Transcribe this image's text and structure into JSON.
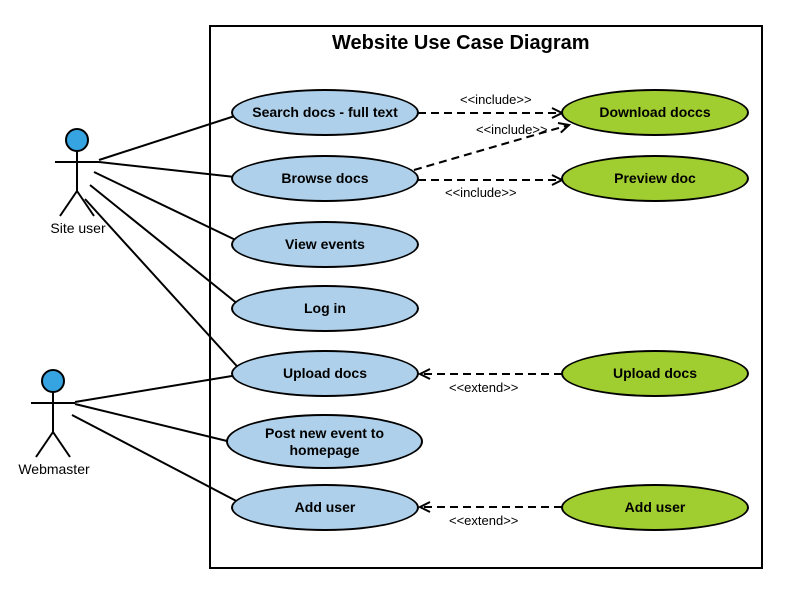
{
  "title": "Website Use Case Diagram",
  "actors": {
    "site_user": "Site user",
    "webmaster": "Webmaster"
  },
  "usecases": {
    "search_docs": "Search docs - full text",
    "browse_docs": "Browse docs",
    "view_events": "View events",
    "log_in": "Log in",
    "upload_docs_blue": "Upload docs",
    "post_event": "Post new event to\nhomepage",
    "add_user_blue": "Add user",
    "download_doccs": "Download doccs",
    "preview_doc": "Preview doc",
    "upload_docs_green": "Upload docs",
    "add_user_green": "Add user"
  },
  "relations": {
    "include": "<<include>>",
    "extend": "<<extend>>"
  }
}
